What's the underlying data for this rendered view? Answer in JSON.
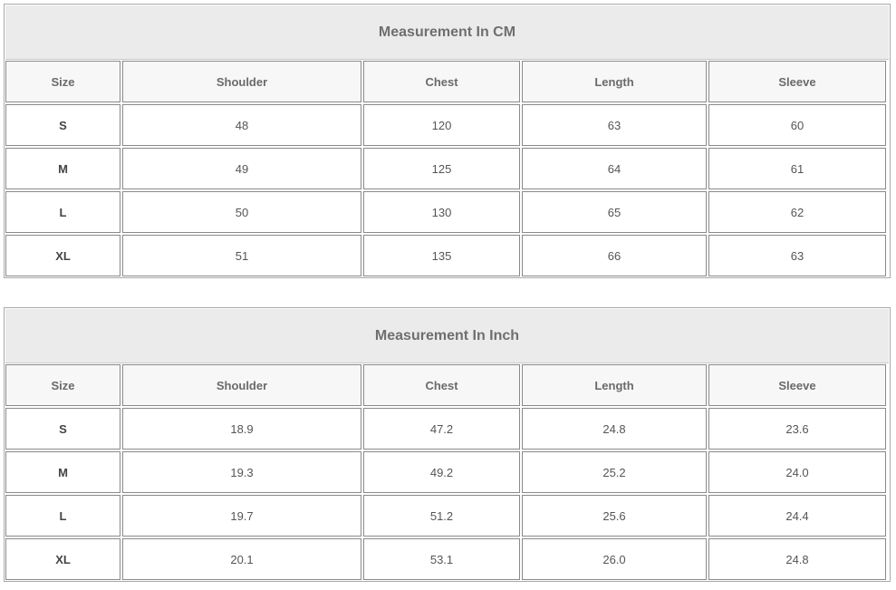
{
  "tables": [
    {
      "title": "Measurement In CM",
      "headers": [
        "Size",
        "Shoulder",
        "Chest",
        "Length",
        "Sleeve"
      ],
      "rows": [
        [
          "S",
          "48",
          "120",
          "63",
          "60"
        ],
        [
          "M",
          "49",
          "125",
          "64",
          "61"
        ],
        [
          "L",
          "50",
          "130",
          "65",
          "62"
        ],
        [
          "XL",
          "51",
          "135",
          "66",
          "63"
        ]
      ]
    },
    {
      "title": "Measurement In Inch",
      "headers": [
        "Size",
        "Shoulder",
        "Chest",
        "Length",
        "Sleeve"
      ],
      "rows": [
        [
          "S",
          "18.9",
          "47.2",
          "24.8",
          "23.6"
        ],
        [
          "M",
          "19.3",
          "49.2",
          "25.2",
          "24.0"
        ],
        [
          "L",
          "19.7",
          "51.2",
          "25.6",
          "24.4"
        ],
        [
          "XL",
          "20.1",
          "53.1",
          "26.0",
          "24.8"
        ]
      ]
    }
  ]
}
